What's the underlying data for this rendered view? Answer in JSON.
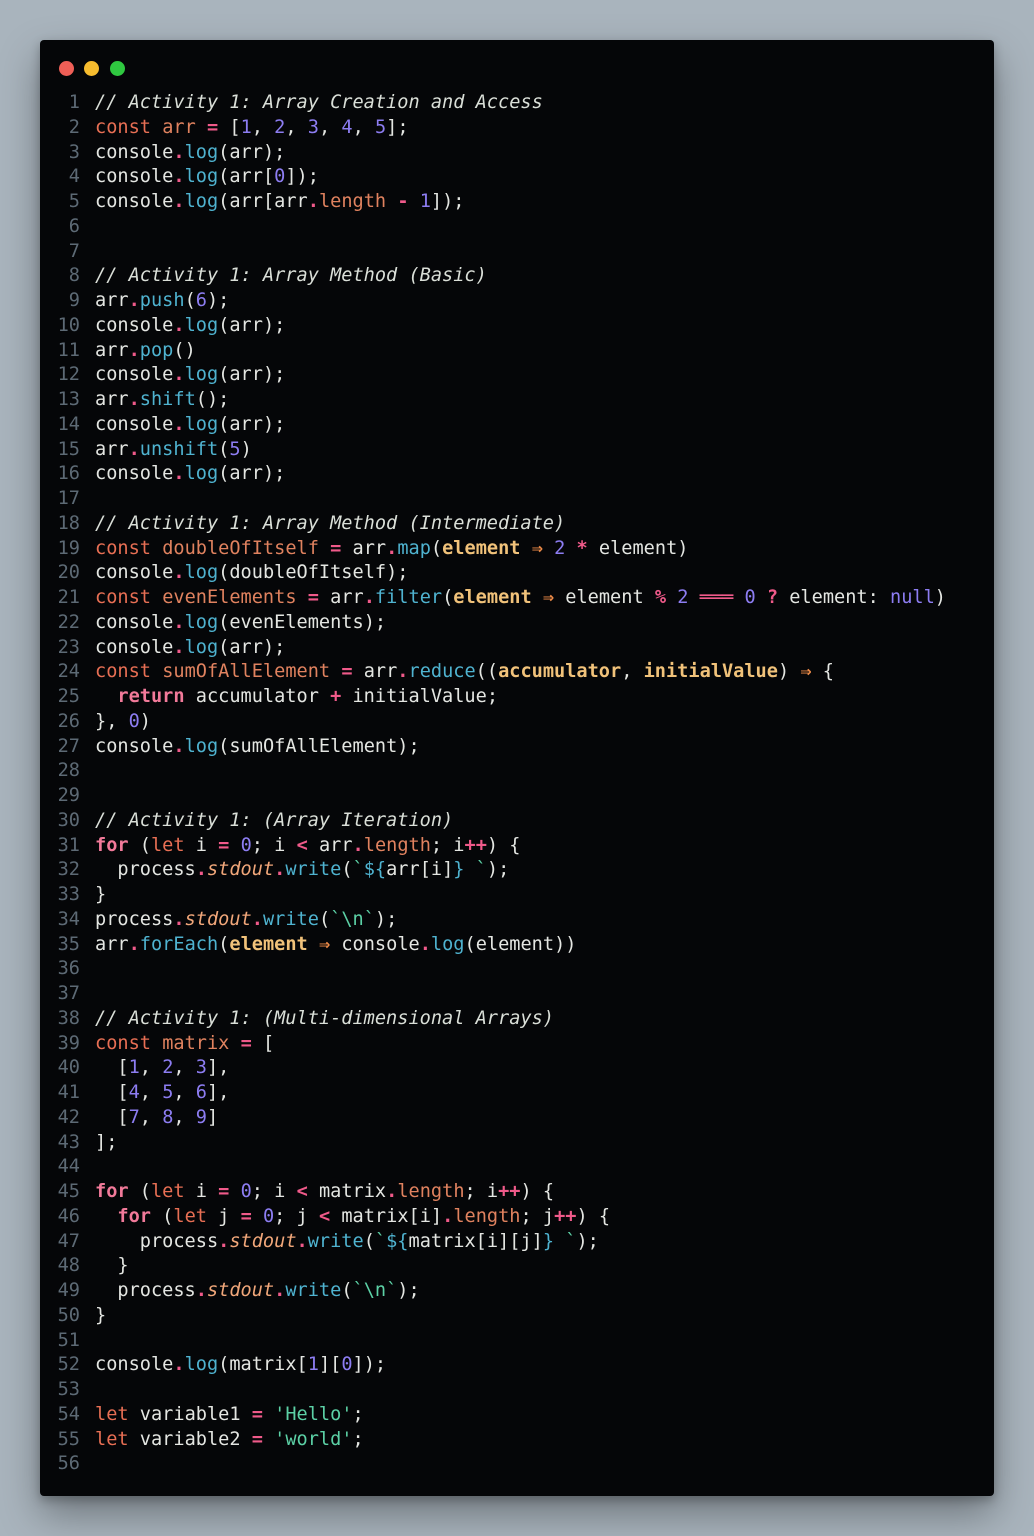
{
  "window": {
    "controls": [
      {
        "name": "close",
        "color": "#ef5f57"
      },
      {
        "name": "minimize",
        "color": "#f7bc2e"
      },
      {
        "name": "maximize",
        "color": "#2fc840"
      }
    ]
  },
  "editor": {
    "language": "javascript",
    "lines": [
      [
        [
          "cm",
          "// Activity 1: Array Creation and Access"
        ]
      ],
      [
        [
          "kw",
          "const"
        ],
        [
          "p",
          " "
        ],
        [
          "prop",
          "arr"
        ],
        [
          "p",
          " "
        ],
        [
          "op",
          "="
        ],
        [
          "p",
          " ["
        ],
        [
          "num",
          "1"
        ],
        [
          "p",
          ", "
        ],
        [
          "num",
          "2"
        ],
        [
          "p",
          ", "
        ],
        [
          "num",
          "3"
        ],
        [
          "p",
          ", "
        ],
        [
          "num",
          "4"
        ],
        [
          "p",
          ", "
        ],
        [
          "num",
          "5"
        ],
        [
          "p",
          "];"
        ]
      ],
      [
        [
          "p",
          "console"
        ],
        [
          "op",
          "."
        ],
        [
          "fn",
          "log"
        ],
        [
          "p",
          "(arr);"
        ]
      ],
      [
        [
          "p",
          "console"
        ],
        [
          "op",
          "."
        ],
        [
          "fn",
          "log"
        ],
        [
          "p",
          "(arr["
        ],
        [
          "num",
          "0"
        ],
        [
          "p",
          "]);"
        ]
      ],
      [
        [
          "p",
          "console"
        ],
        [
          "op",
          "."
        ],
        [
          "fn",
          "log"
        ],
        [
          "p",
          "(arr[arr"
        ],
        [
          "op",
          "."
        ],
        [
          "prop",
          "length"
        ],
        [
          "p",
          " "
        ],
        [
          "op",
          "-"
        ],
        [
          "p",
          " "
        ],
        [
          "num",
          "1"
        ],
        [
          "p",
          "]);"
        ]
      ],
      [],
      [],
      [
        [
          "cm",
          "// Activity 1: Array Method (Basic)"
        ]
      ],
      [
        [
          "p",
          "arr"
        ],
        [
          "op",
          "."
        ],
        [
          "fn",
          "push"
        ],
        [
          "p",
          "("
        ],
        [
          "num",
          "6"
        ],
        [
          "p",
          ");"
        ]
      ],
      [
        [
          "p",
          "console"
        ],
        [
          "op",
          "."
        ],
        [
          "fn",
          "log"
        ],
        [
          "p",
          "(arr);"
        ]
      ],
      [
        [
          "p",
          "arr"
        ],
        [
          "op",
          "."
        ],
        [
          "fn",
          "pop"
        ],
        [
          "p",
          "()"
        ]
      ],
      [
        [
          "p",
          "console"
        ],
        [
          "op",
          "."
        ],
        [
          "fn",
          "log"
        ],
        [
          "p",
          "(arr);"
        ]
      ],
      [
        [
          "p",
          "arr"
        ],
        [
          "op",
          "."
        ],
        [
          "fn",
          "shift"
        ],
        [
          "p",
          "();"
        ]
      ],
      [
        [
          "p",
          "console"
        ],
        [
          "op",
          "."
        ],
        [
          "fn",
          "log"
        ],
        [
          "p",
          "(arr);"
        ]
      ],
      [
        [
          "p",
          "arr"
        ],
        [
          "op",
          "."
        ],
        [
          "fn",
          "unshift"
        ],
        [
          "p",
          "("
        ],
        [
          "num",
          "5"
        ],
        [
          "p",
          ")"
        ]
      ],
      [
        [
          "p",
          "console"
        ],
        [
          "op",
          "."
        ],
        [
          "fn",
          "log"
        ],
        [
          "p",
          "(arr);"
        ]
      ],
      [],
      [
        [
          "cm",
          "// Activity 1: Array Method (Intermediate)"
        ]
      ],
      [
        [
          "kw",
          "const"
        ],
        [
          "p",
          " "
        ],
        [
          "prop",
          "doubleOfItself"
        ],
        [
          "p",
          " "
        ],
        [
          "op",
          "="
        ],
        [
          "p",
          " arr"
        ],
        [
          "op",
          "."
        ],
        [
          "fn",
          "map"
        ],
        [
          "p",
          "("
        ],
        [
          "param",
          "element"
        ],
        [
          "p",
          " "
        ],
        [
          "arrow",
          "⇒"
        ],
        [
          "p",
          " "
        ],
        [
          "num",
          "2"
        ],
        [
          "p",
          " "
        ],
        [
          "op",
          "*"
        ],
        [
          "p",
          " element)"
        ]
      ],
      [
        [
          "p",
          "console"
        ],
        [
          "op",
          "."
        ],
        [
          "fn",
          "log"
        ],
        [
          "p",
          "(doubleOfItself);"
        ]
      ],
      [
        [
          "kw",
          "const"
        ],
        [
          "p",
          " "
        ],
        [
          "prop",
          "evenElements"
        ],
        [
          "p",
          " "
        ],
        [
          "op",
          "="
        ],
        [
          "p",
          " arr"
        ],
        [
          "op",
          "."
        ],
        [
          "fn",
          "filter"
        ],
        [
          "p",
          "("
        ],
        [
          "param",
          "element"
        ],
        [
          "p",
          " "
        ],
        [
          "arrow",
          "⇒"
        ],
        [
          "p",
          " element "
        ],
        [
          "op",
          "%"
        ],
        [
          "p",
          " "
        ],
        [
          "num",
          "2"
        ],
        [
          "p",
          " "
        ],
        [
          "op",
          "═══"
        ],
        [
          "p",
          " "
        ],
        [
          "num",
          "0"
        ],
        [
          "p",
          " "
        ],
        [
          "op",
          "?"
        ],
        [
          "p",
          " element: "
        ],
        [
          "num",
          "null"
        ],
        [
          "p",
          ")"
        ]
      ],
      [
        [
          "p",
          "console"
        ],
        [
          "op",
          "."
        ],
        [
          "fn",
          "log"
        ],
        [
          "p",
          "(evenElements);"
        ]
      ],
      [
        [
          "p",
          "console"
        ],
        [
          "op",
          "."
        ],
        [
          "fn",
          "log"
        ],
        [
          "p",
          "(arr);"
        ]
      ],
      [
        [
          "kw",
          "const"
        ],
        [
          "p",
          " "
        ],
        [
          "prop",
          "sumOfAllElement"
        ],
        [
          "p",
          " "
        ],
        [
          "op",
          "="
        ],
        [
          "p",
          " arr"
        ],
        [
          "op",
          "."
        ],
        [
          "fn",
          "reduce"
        ],
        [
          "p",
          "(("
        ],
        [
          "param",
          "accumulator"
        ],
        [
          "p",
          ", "
        ],
        [
          "param",
          "initialValue"
        ],
        [
          "p",
          ") "
        ],
        [
          "arrow",
          "⇒"
        ],
        [
          "p",
          " {"
        ]
      ],
      [
        [
          "p",
          "  "
        ],
        [
          "kwb",
          "return"
        ],
        [
          "p",
          " accumulator "
        ],
        [
          "op",
          "+"
        ],
        [
          "p",
          " initialValue;"
        ]
      ],
      [
        [
          "p",
          "}, "
        ],
        [
          "num",
          "0"
        ],
        [
          "p",
          ")"
        ]
      ],
      [
        [
          "p",
          "console"
        ],
        [
          "op",
          "."
        ],
        [
          "fn",
          "log"
        ],
        [
          "p",
          "(sumOfAllElement);"
        ]
      ],
      [],
      [],
      [
        [
          "cm",
          "// Activity 1: (Array Iteration)"
        ]
      ],
      [
        [
          "kwb",
          "for"
        ],
        [
          "p",
          " ("
        ],
        [
          "kw",
          "let"
        ],
        [
          "p",
          " i "
        ],
        [
          "op",
          "="
        ],
        [
          "p",
          " "
        ],
        [
          "num",
          "0"
        ],
        [
          "p",
          "; i "
        ],
        [
          "op",
          "<"
        ],
        [
          "p",
          " arr"
        ],
        [
          "op",
          "."
        ],
        [
          "prop",
          "length"
        ],
        [
          "p",
          "; i"
        ],
        [
          "op",
          "++"
        ],
        [
          "p",
          ") {"
        ]
      ],
      [
        [
          "p",
          "  process"
        ],
        [
          "op",
          "."
        ],
        [
          "it",
          "stdout"
        ],
        [
          "op",
          "."
        ],
        [
          "fn",
          "write"
        ],
        [
          "p",
          "("
        ],
        [
          "tpl",
          "`"
        ],
        [
          "tplx",
          "${"
        ],
        [
          "p",
          "arr[i]"
        ],
        [
          "tplx",
          "}"
        ],
        [
          "tpl",
          " `"
        ],
        [
          "p",
          ");"
        ]
      ],
      [
        [
          "p",
          "}"
        ]
      ],
      [
        [
          "p",
          "process"
        ],
        [
          "op",
          "."
        ],
        [
          "it",
          "stdout"
        ],
        [
          "op",
          "."
        ],
        [
          "fn",
          "write"
        ],
        [
          "p",
          "("
        ],
        [
          "tpl",
          "`\\n`"
        ],
        [
          "p",
          ");"
        ]
      ],
      [
        [
          "p",
          "arr"
        ],
        [
          "op",
          "."
        ],
        [
          "fn",
          "forEach"
        ],
        [
          "p",
          "("
        ],
        [
          "param",
          "element"
        ],
        [
          "p",
          " "
        ],
        [
          "arrow",
          "⇒"
        ],
        [
          "p",
          " console"
        ],
        [
          "op",
          "."
        ],
        [
          "fn",
          "log"
        ],
        [
          "p",
          "(element))"
        ]
      ],
      [],
      [],
      [
        [
          "cm",
          "// Activity 1: (Multi-dimensional Arrays)"
        ]
      ],
      [
        [
          "kw",
          "const"
        ],
        [
          "p",
          " "
        ],
        [
          "prop",
          "matrix"
        ],
        [
          "p",
          " "
        ],
        [
          "op",
          "="
        ],
        [
          "p",
          " ["
        ]
      ],
      [
        [
          "p",
          "  ["
        ],
        [
          "num",
          "1"
        ],
        [
          "p",
          ", "
        ],
        [
          "num",
          "2"
        ],
        [
          "p",
          ", "
        ],
        [
          "num",
          "3"
        ],
        [
          "p",
          "],"
        ]
      ],
      [
        [
          "p",
          "  ["
        ],
        [
          "num",
          "4"
        ],
        [
          "p",
          ", "
        ],
        [
          "num",
          "5"
        ],
        [
          "p",
          ", "
        ],
        [
          "num",
          "6"
        ],
        [
          "p",
          "],"
        ]
      ],
      [
        [
          "p",
          "  ["
        ],
        [
          "num",
          "7"
        ],
        [
          "p",
          ", "
        ],
        [
          "num",
          "8"
        ],
        [
          "p",
          ", "
        ],
        [
          "num",
          "9"
        ],
        [
          "p",
          "]"
        ]
      ],
      [
        [
          "p",
          "];"
        ]
      ],
      [],
      [
        [
          "kwb",
          "for"
        ],
        [
          "p",
          " ("
        ],
        [
          "kw",
          "let"
        ],
        [
          "p",
          " i "
        ],
        [
          "op",
          "="
        ],
        [
          "p",
          " "
        ],
        [
          "num",
          "0"
        ],
        [
          "p",
          "; i "
        ],
        [
          "op",
          "<"
        ],
        [
          "p",
          " matrix"
        ],
        [
          "op",
          "."
        ],
        [
          "prop",
          "length"
        ],
        [
          "p",
          "; i"
        ],
        [
          "op",
          "++"
        ],
        [
          "p",
          ") {"
        ]
      ],
      [
        [
          "p",
          "  "
        ],
        [
          "kwb",
          "for"
        ],
        [
          "p",
          " ("
        ],
        [
          "kw",
          "let"
        ],
        [
          "p",
          " j "
        ],
        [
          "op",
          "="
        ],
        [
          "p",
          " "
        ],
        [
          "num",
          "0"
        ],
        [
          "p",
          "; j "
        ],
        [
          "op",
          "<"
        ],
        [
          "p",
          " matrix[i]"
        ],
        [
          "op",
          "."
        ],
        [
          "prop",
          "length"
        ],
        [
          "p",
          "; j"
        ],
        [
          "op",
          "++"
        ],
        [
          "p",
          ") {"
        ]
      ],
      [
        [
          "p",
          "    process"
        ],
        [
          "op",
          "."
        ],
        [
          "it",
          "stdout"
        ],
        [
          "op",
          "."
        ],
        [
          "fn",
          "write"
        ],
        [
          "p",
          "("
        ],
        [
          "tpl",
          "`"
        ],
        [
          "tplx",
          "${"
        ],
        [
          "p",
          "matrix[i][j]"
        ],
        [
          "tplx",
          "}"
        ],
        [
          "tpl",
          " `"
        ],
        [
          "p",
          ");"
        ]
      ],
      [
        [
          "p",
          "  }"
        ]
      ],
      [
        [
          "p",
          "  process"
        ],
        [
          "op",
          "."
        ],
        [
          "it",
          "stdout"
        ],
        [
          "op",
          "."
        ],
        [
          "fn",
          "write"
        ],
        [
          "p",
          "("
        ],
        [
          "tpl",
          "`\\n`"
        ],
        [
          "p",
          ");"
        ]
      ],
      [
        [
          "p",
          "}"
        ]
      ],
      [],
      [
        [
          "p",
          "console"
        ],
        [
          "op",
          "."
        ],
        [
          "fn",
          "log"
        ],
        [
          "p",
          "(matrix["
        ],
        [
          "num",
          "1"
        ],
        [
          "p",
          "]["
        ],
        [
          "num",
          "0"
        ],
        [
          "p",
          "]);"
        ]
      ],
      [],
      [
        [
          "kw",
          "let"
        ],
        [
          "p",
          " variable1 "
        ],
        [
          "op",
          "="
        ],
        [
          "p",
          " "
        ],
        [
          "str",
          "'Hello'"
        ],
        [
          "p",
          ";"
        ]
      ],
      [
        [
          "kw",
          "let"
        ],
        [
          "p",
          " variable2 "
        ],
        [
          "op",
          "="
        ],
        [
          "p",
          " "
        ],
        [
          "str",
          "'world'"
        ],
        [
          "p",
          ";"
        ]
      ],
      []
    ]
  }
}
